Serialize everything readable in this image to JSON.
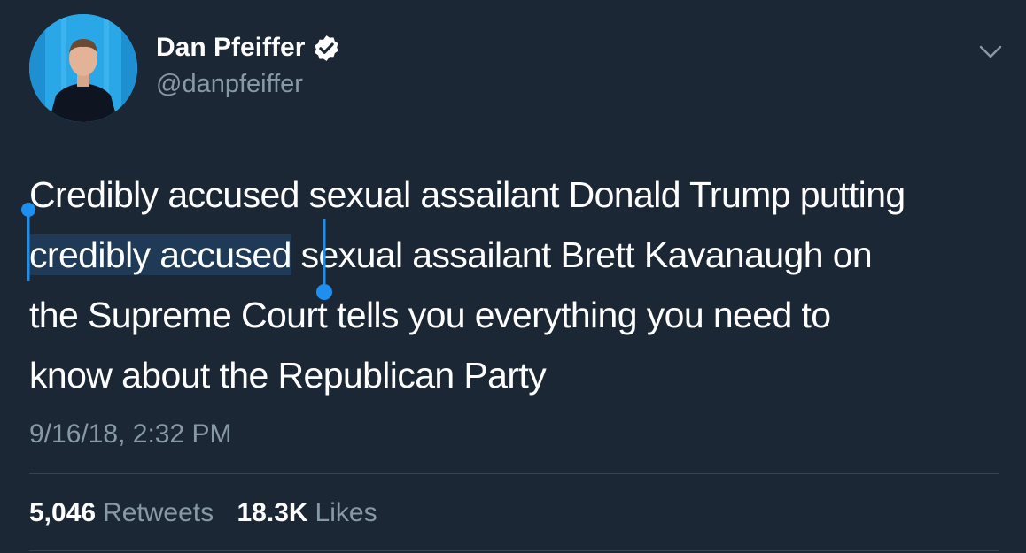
{
  "author": {
    "name": "Dan Pfeiffer",
    "handle": "@danpfeiffer",
    "verified_icon": "verified-badge-icon",
    "avatar_bg": "#2aa7e6"
  },
  "tweet": {
    "lines": [
      {
        "before": "Credibly accused sexual assailant Donald Trump putting",
        "selected": "",
        "after": ""
      },
      {
        "before": "",
        "selected": "credibly accused",
        "after": " sexual assailant Brett Kavanaugh on"
      },
      {
        "before": "the Supreme Court tells you everything you need to",
        "selected": "",
        "after": ""
      },
      {
        "before": "know about the Republican Party",
        "selected": "",
        "after": ""
      }
    ],
    "timestamp": "9/16/18, 2:32 PM"
  },
  "stats": {
    "retweets_count": "5,046",
    "retweets_label": "Retweets",
    "likes_count": "18.3K",
    "likes_label": "Likes"
  },
  "icons": {
    "caret": "chevron-down-icon"
  },
  "colors": {
    "background": "#1b2734",
    "text": "#ffffff",
    "secondary": "#8899a6",
    "selection": "#1e3a57",
    "selection_handle": "#1d8ff0"
  }
}
